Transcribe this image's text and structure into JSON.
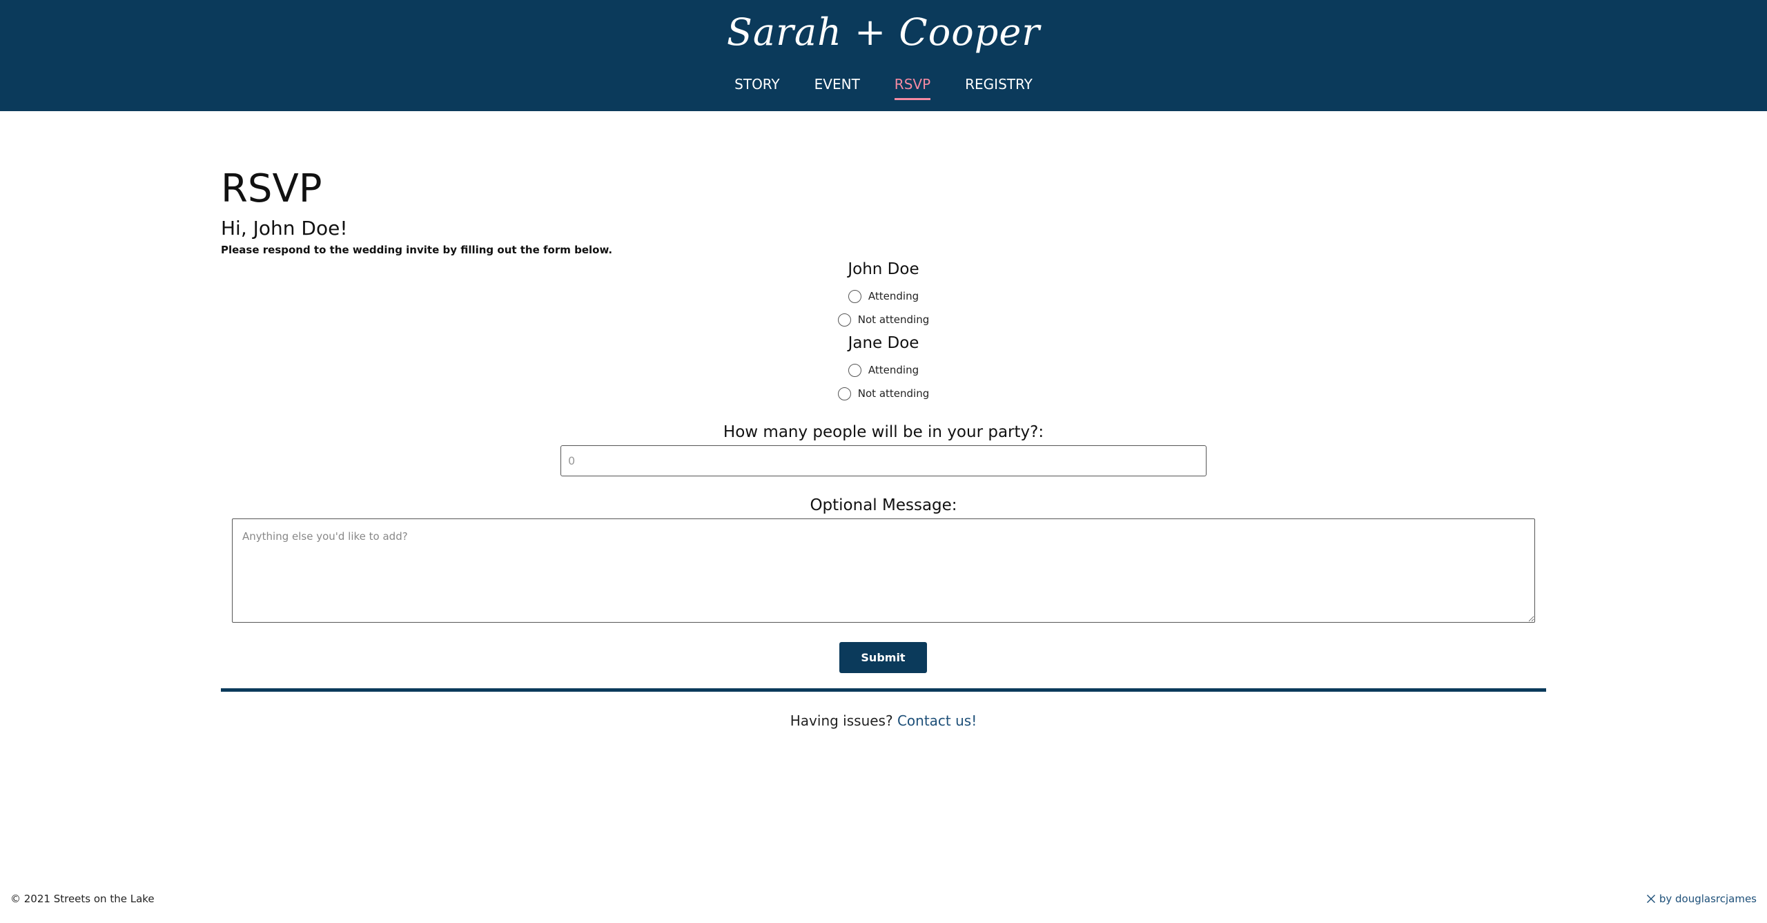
{
  "header": {
    "brand": "Sarah + Cooper",
    "nav": [
      {
        "label": "STORY",
        "active": false
      },
      {
        "label": "EVENT",
        "active": false
      },
      {
        "label": "RSVP",
        "active": true
      },
      {
        "label": "REGISTRY",
        "active": false
      }
    ],
    "active_color": "#f48aa2",
    "background_color": "#0b3a5b"
  },
  "main": {
    "title": "RSVP",
    "greeting": "Hi, John Doe!",
    "intro": "Please respond to the wedding invite by filling out the form below.",
    "guests": [
      {
        "name": "John Doe",
        "options": [
          {
            "label": "Attending",
            "checked": false
          },
          {
            "label": "Not attending",
            "checked": false
          }
        ]
      },
      {
        "name": "Jane Doe",
        "options": [
          {
            "label": "Attending",
            "checked": false
          },
          {
            "label": "Not attending",
            "checked": false
          }
        ]
      }
    ],
    "party": {
      "label": "How many people will be in your party?:",
      "placeholder": "0",
      "value": ""
    },
    "message": {
      "label": "Optional Message:",
      "placeholder": "Anything else you'd like to add?",
      "value": ""
    },
    "submit_label": "Submit",
    "help": {
      "text": "Having issues?",
      "link_label": "Contact us!"
    }
  },
  "footer": {
    "copyright": "© 2021 Streets on the Lake",
    "credit": "by douglasrcjames",
    "credit_icon": "tools-icon",
    "accent_color": "#1d4f78"
  }
}
